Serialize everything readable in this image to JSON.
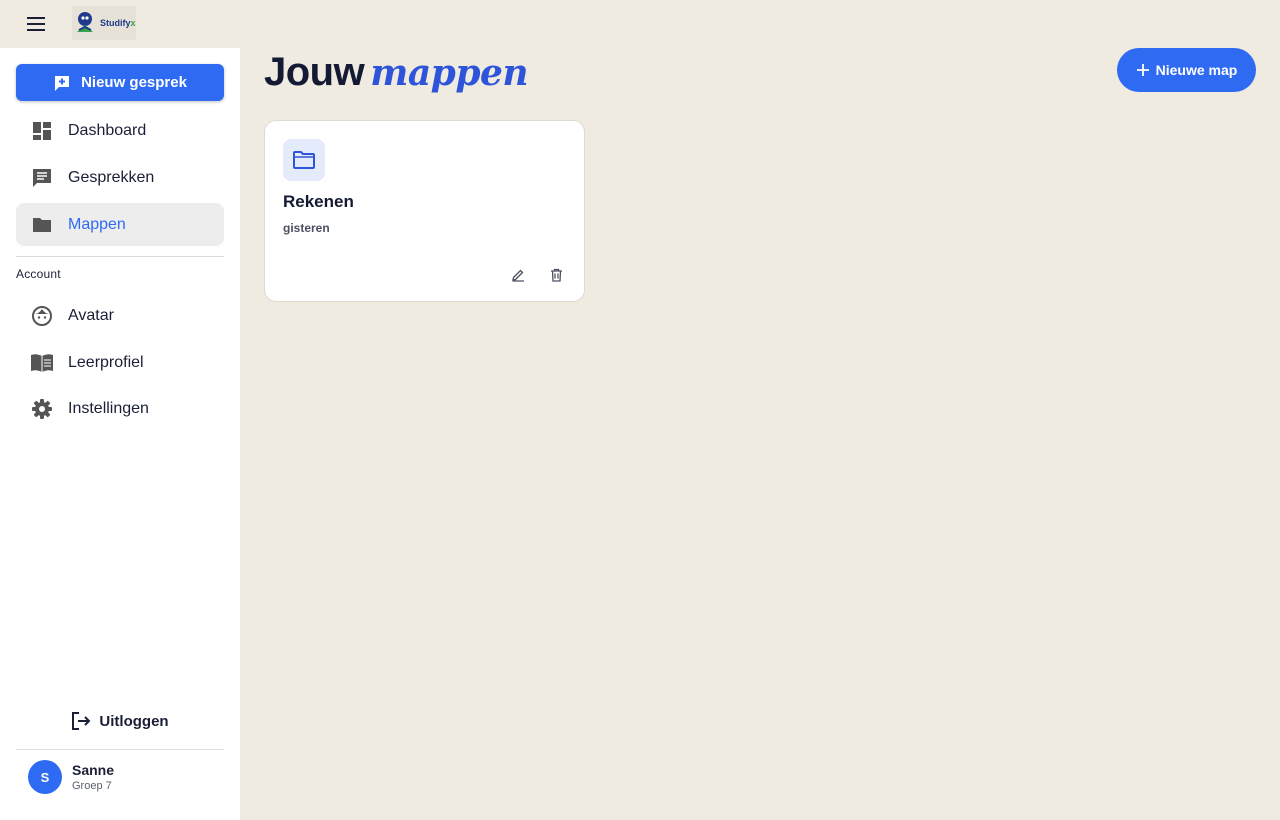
{
  "app": {
    "logo_text": "Studify",
    "logo_accent": "x"
  },
  "sidebar": {
    "new_chat_label": "Nieuw gesprek",
    "items": [
      {
        "label": "Dashboard",
        "icon": "dashboard-icon"
      },
      {
        "label": "Gesprekken",
        "icon": "chat-icon"
      },
      {
        "label": "Mappen",
        "icon": "folder-icon",
        "active": true
      }
    ],
    "section_label": "Account",
    "account_items": [
      {
        "label": "Avatar",
        "icon": "face-icon"
      },
      {
        "label": "Leerprofiel",
        "icon": "book-icon"
      },
      {
        "label": "Instellingen",
        "icon": "gear-icon"
      }
    ],
    "logout_label": "Uitloggen",
    "user": {
      "initial": "S",
      "name": "Sanne",
      "group": "Groep 7"
    }
  },
  "main": {
    "title_plain": "Jouw",
    "title_accent": "mappen",
    "new_folder_label": "Nieuwe map",
    "folders": [
      {
        "name": "Rekenen",
        "date": "gisteren"
      }
    ]
  },
  "colors": {
    "accent": "#2f6bf2",
    "background": "#f0ebe1",
    "title_accent": "#2e55d9"
  }
}
